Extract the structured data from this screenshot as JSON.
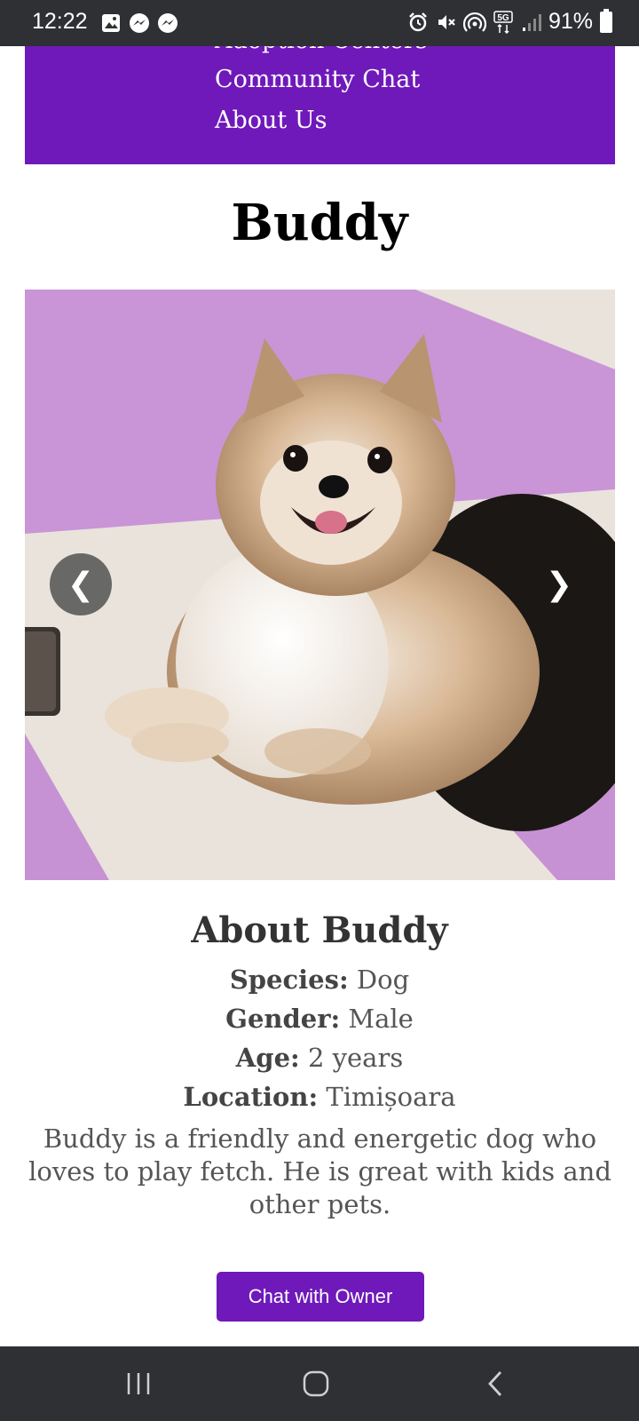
{
  "status_bar": {
    "time": "12:22",
    "battery": "91%",
    "left_icons": [
      "gallery-icon",
      "messenger-icon",
      "messenger-icon"
    ],
    "right_icons": [
      "alarm-icon",
      "mute-icon",
      "hotspot-icon",
      "5g-icon",
      "signal-icon",
      "battery-icon"
    ]
  },
  "nav": {
    "items": [
      {
        "label": "Adoption Centers"
      },
      {
        "label": "Community Chat"
      },
      {
        "label": "About Us"
      }
    ]
  },
  "pet": {
    "name": "Buddy",
    "about_heading": "About Buddy",
    "details": [
      {
        "label": "Species:",
        "value": "Dog"
      },
      {
        "label": "Gender:",
        "value": "Male"
      },
      {
        "label": "Age:",
        "value": "2 years"
      },
      {
        "label": "Location:",
        "value": "Timișoara"
      }
    ],
    "description": "Buddy is a friendly and energetic dog who loves to play fetch. He is great with kids and other pets."
  },
  "carousel": {
    "prev_label": "❮",
    "next_label": "❯"
  },
  "actions": {
    "chat_label": "Chat with Owner"
  },
  "colors": {
    "primary": "#6f19ba",
    "system_bar": "#2f3034"
  }
}
